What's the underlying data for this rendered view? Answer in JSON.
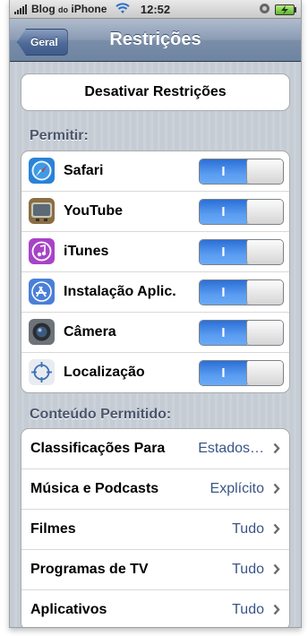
{
  "status": {
    "carrier": "Blog",
    "carrier_small": "do",
    "carrier_suffix": "iPhone",
    "time": "12:52"
  },
  "nav": {
    "back_label": "Geral",
    "title": "Restrições"
  },
  "disable_button": "Desativar Restrições",
  "allow": {
    "header": "Permitir:",
    "items": [
      {
        "label": "Safari",
        "icon": "safari-icon",
        "toggle": "I"
      },
      {
        "label": "YouTube",
        "icon": "youtube-icon",
        "toggle": "I"
      },
      {
        "label": "iTunes",
        "icon": "itunes-icon",
        "toggle": "I"
      },
      {
        "label": "Instalação Aplic.",
        "icon": "app-store-icon",
        "toggle": "I"
      },
      {
        "label": "Câmera",
        "icon": "camera-icon",
        "toggle": "I"
      },
      {
        "label": "Localização",
        "icon": "location-icon",
        "toggle": "I"
      }
    ]
  },
  "content": {
    "header": "Conteúdo Permitido:",
    "items": [
      {
        "label": "Classificações Para",
        "value": "Estados…"
      },
      {
        "label": "Música e Podcasts",
        "value": "Explícito"
      },
      {
        "label": "Filmes",
        "value": "Tudo"
      },
      {
        "label": "Programas de TV",
        "value": "Tudo"
      },
      {
        "label": "Aplicativos",
        "value": "Tudo"
      }
    ]
  },
  "colors": {
    "toggle_on": "#3d85e6",
    "value_text": "#385487",
    "section_text": "#4c566c"
  }
}
